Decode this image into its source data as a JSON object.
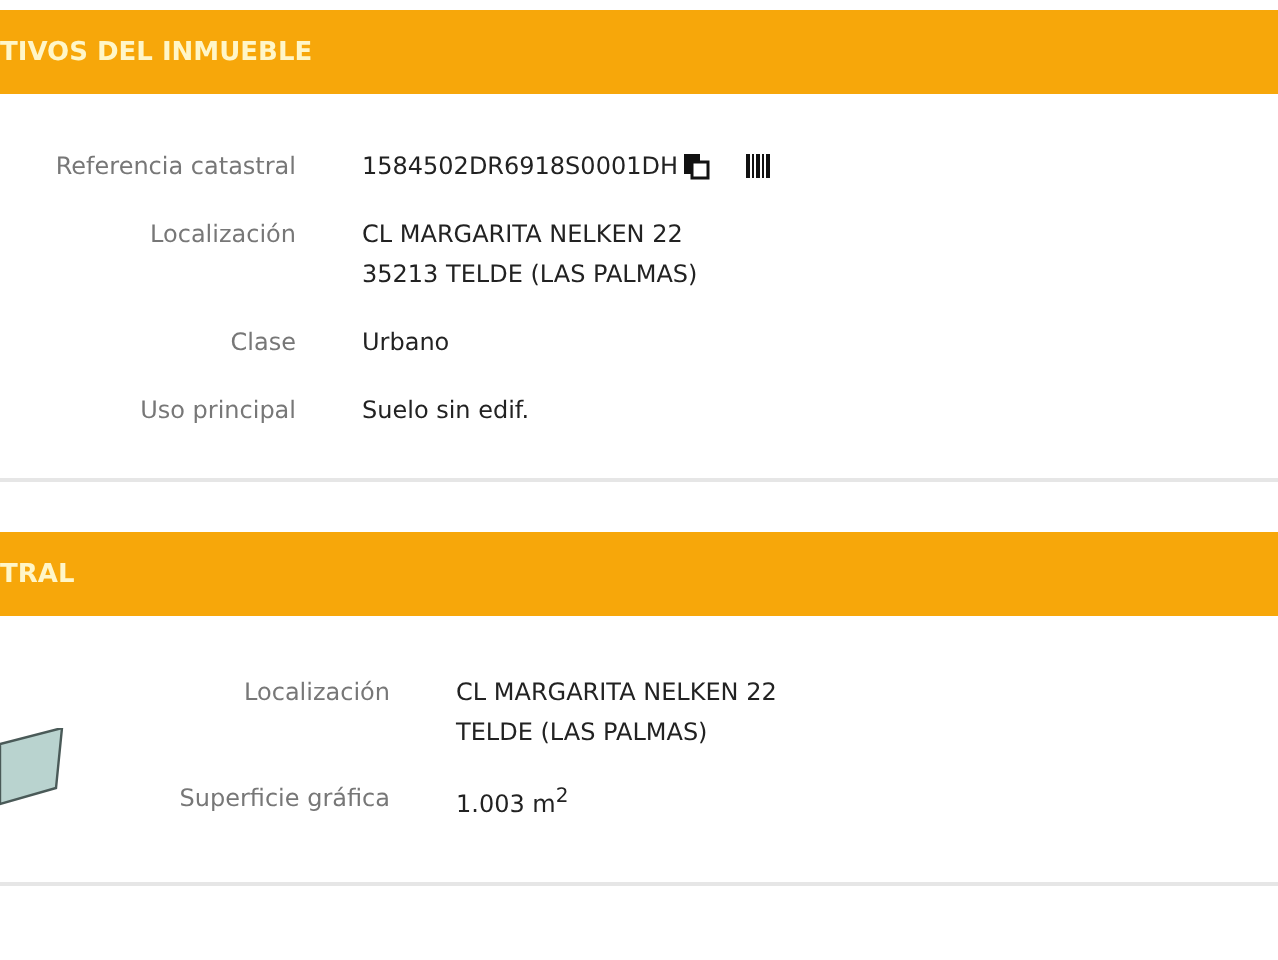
{
  "sections": [
    {
      "title": "TIVOS DEL INMUEBLE",
      "has_parcel": false,
      "rows": [
        {
          "label": "Referencia catastral",
          "lines": [
            "1584502DR6918S0001DH"
          ],
          "kind": "reference"
        },
        {
          "label": "Localización",
          "lines": [
            "CL MARGARITA NELKEN 22",
            "35213 TELDE (LAS PALMAS)"
          ],
          "kind": "text"
        },
        {
          "label": "Clase",
          "lines": [
            "Urbano"
          ],
          "kind": "text"
        },
        {
          "label": "Uso principal",
          "lines": [
            "Suelo sin edif."
          ],
          "kind": "text"
        }
      ]
    },
    {
      "title": "TRAL",
      "has_parcel": true,
      "rows": [
        {
          "label": "Localización",
          "lines": [
            "CL MARGARITA NELKEN 22",
            "TELDE (LAS PALMAS)"
          ],
          "kind": "text"
        },
        {
          "label": "Superficie gráfica",
          "lines": [
            "1.003 m$^{2}$"
          ],
          "kind": "text"
        }
      ]
    }
  ]
}
